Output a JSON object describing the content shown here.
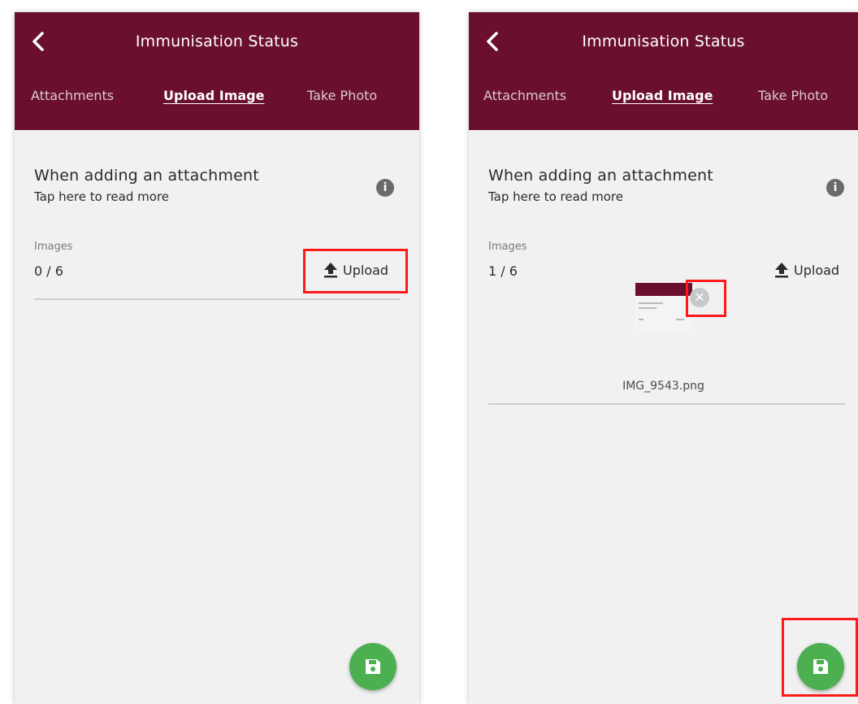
{
  "screens": [
    {
      "header": {
        "title": "Immunisation Status",
        "tabs": [
          {
            "label": "Attachments",
            "active": false
          },
          {
            "label": "Upload Image",
            "active": true
          },
          {
            "label": "Take Photo",
            "active": false
          }
        ]
      },
      "info": {
        "title": "When adding an attachment",
        "subtitle": "Tap here to read more",
        "icon": "i"
      },
      "images": {
        "label": "Images",
        "count": "0 / 6"
      },
      "upload": {
        "label": "Upload",
        "icon": "upload-icon"
      },
      "fab": {
        "icon": "save-icon"
      },
      "highlighted": [
        "upload-button"
      ]
    },
    {
      "header": {
        "title": "Immunisation Status",
        "tabs": [
          {
            "label": "Attachments",
            "active": false
          },
          {
            "label": "Upload Image",
            "active": true
          },
          {
            "label": "Take Photo",
            "active": false
          }
        ]
      },
      "info": {
        "title": "When adding an attachment",
        "subtitle": "Tap here to read more",
        "icon": "i"
      },
      "images": {
        "label": "Images",
        "count": "1 / 6"
      },
      "upload": {
        "label": "Upload",
        "icon": "upload-icon"
      },
      "attachment": {
        "filename": "IMG_9543.png",
        "remove_icon": "remove-icon"
      },
      "fab": {
        "icon": "save-icon"
      },
      "highlighted": [
        "remove-image-button",
        "save-fab"
      ]
    }
  ],
  "colors": {
    "header_bg": "#6a0f2f",
    "fab_bg": "#4caf50",
    "highlight": "#ff1a1a",
    "page_bg": "#f1f1f2"
  }
}
